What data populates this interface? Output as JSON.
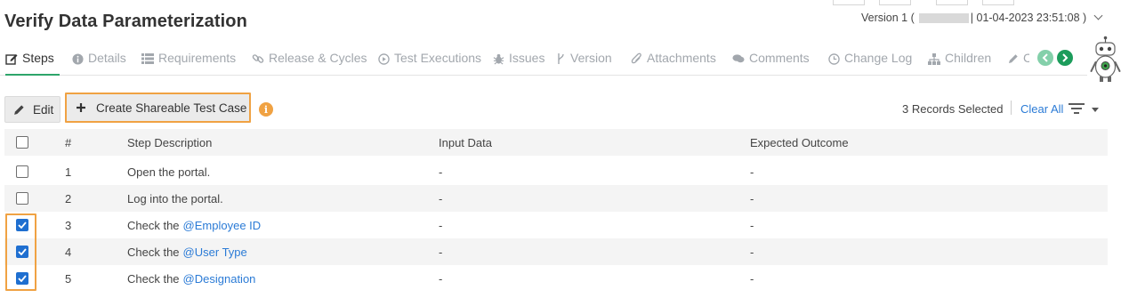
{
  "page": {
    "title": "Verify Data Parameterization",
    "version_prefix": "Version 1 (",
    "version_suffix": "| 01-04-2023 23:51:08 )"
  },
  "tabs": [
    {
      "label": "Steps",
      "icon": "pencil-square-icon",
      "active": true
    },
    {
      "label": "Details",
      "icon": "info-circle-icon"
    },
    {
      "label": "Requirements",
      "icon": "list-icon"
    },
    {
      "label": "Release & Cycles",
      "icon": "link-icon"
    },
    {
      "label": "Test Executions",
      "icon": "play-circle-icon"
    },
    {
      "label": "Issues",
      "icon": "bug-icon"
    },
    {
      "label": "Version",
      "icon": "branch-icon"
    },
    {
      "label": "Attachments",
      "icon": "paperclip-icon"
    },
    {
      "label": "Comments",
      "icon": "comments-icon"
    },
    {
      "label": "Change Log",
      "icon": "clock-icon"
    },
    {
      "label": "Children",
      "icon": "sitemap-icon"
    },
    {
      "label": "C",
      "icon": "pencil-icon"
    }
  ],
  "toolbar": {
    "edit_label": "Edit",
    "create_label": "Create Shareable Test Case",
    "info_glyph": "i",
    "records_selected": "3 Records Selected",
    "clear_all": "Clear All"
  },
  "table": {
    "headers": {
      "num": "#",
      "desc": "Step Description",
      "input": "Input Data",
      "outcome": "Expected Outcome"
    },
    "rows": [
      {
        "num": "1",
        "desc": "Open the portal.",
        "param": "",
        "input": "-",
        "outcome": "-",
        "checked": false
      },
      {
        "num": "2",
        "desc": "Log into the portal.",
        "param": "",
        "input": "-",
        "outcome": "-",
        "checked": false
      },
      {
        "num": "3",
        "desc": "Check the",
        "param": "@Employee ID",
        "input": "-",
        "outcome": "-",
        "checked": true
      },
      {
        "num": "4",
        "desc": "Check the",
        "param": "@User Type",
        "input": "-",
        "outcome": "-",
        "checked": true
      },
      {
        "num": "5",
        "desc": "Check the",
        "param": "@Designation",
        "input": "-",
        "outcome": "-",
        "checked": true
      }
    ]
  },
  "colors": {
    "accent_green": "#2da56a",
    "highlight_orange": "#f0a243",
    "link_blue": "#2b7bd6",
    "checkbox_blue": "#1f6fd0"
  }
}
